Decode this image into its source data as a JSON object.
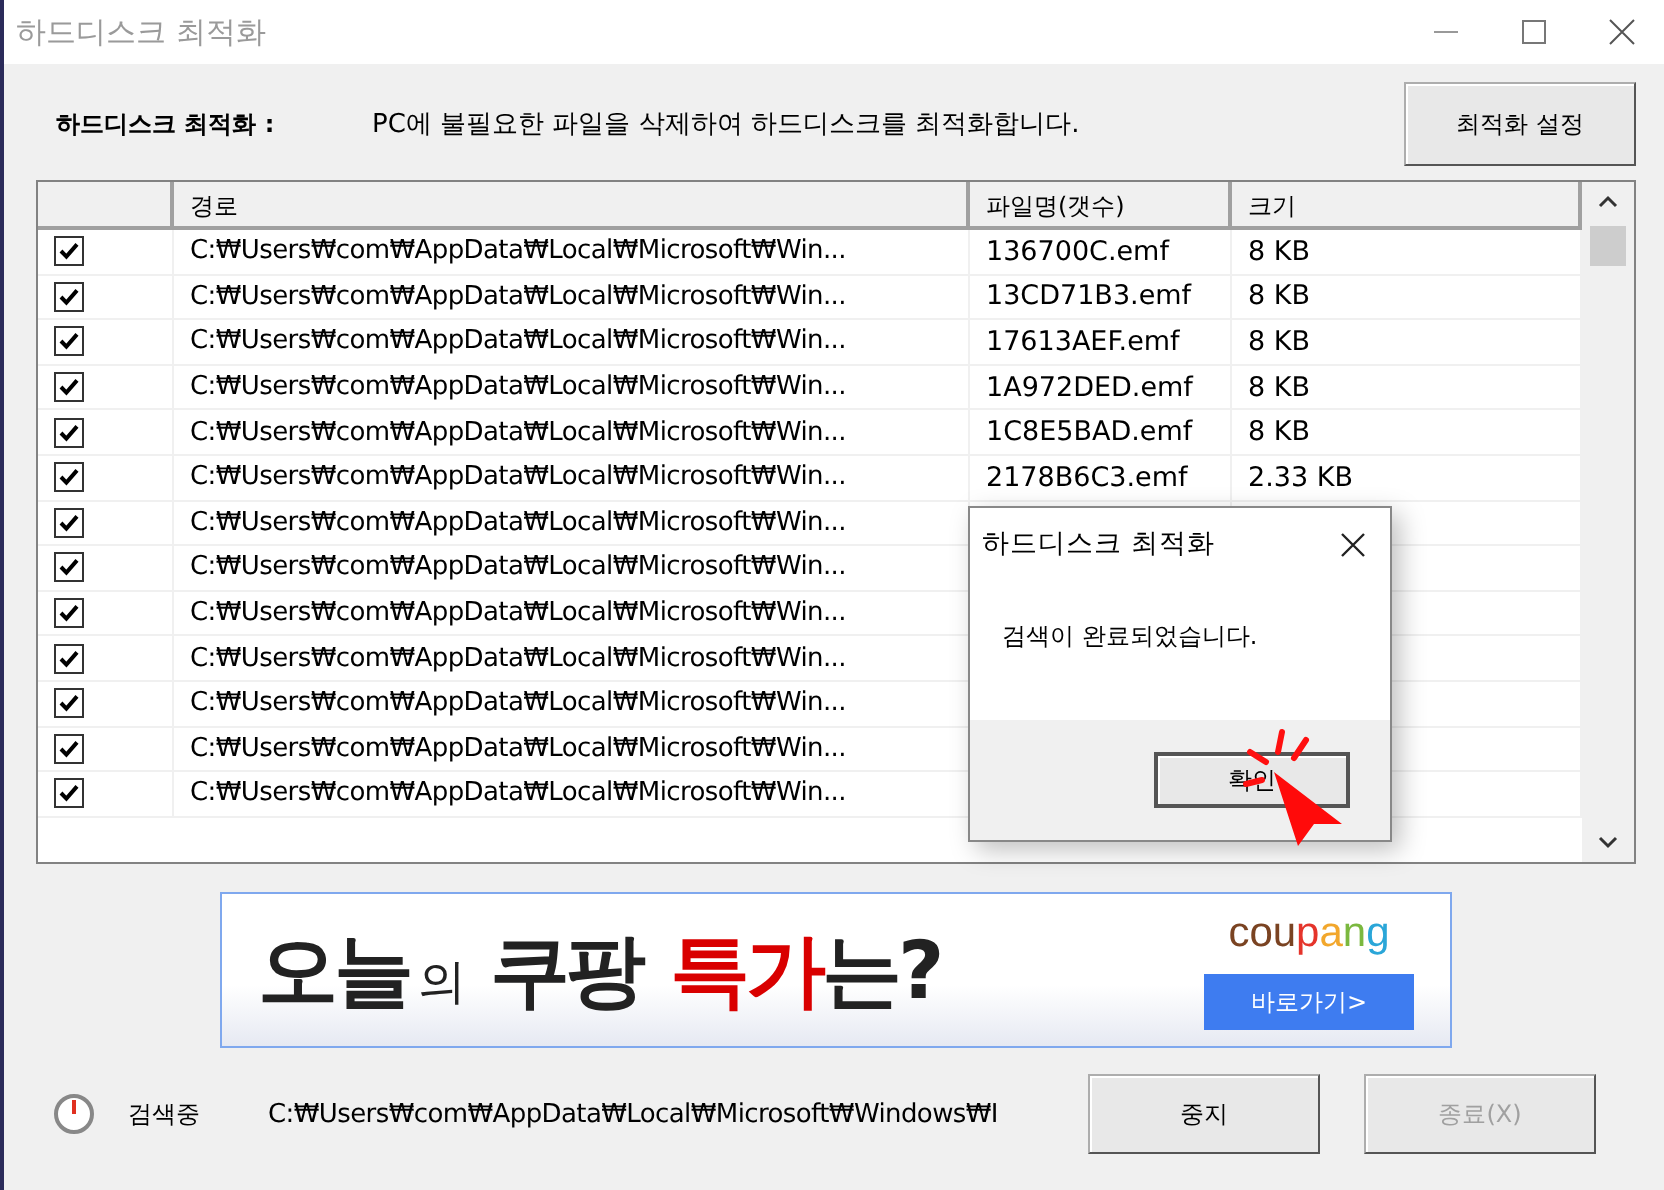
{
  "window": {
    "title": "하드디스크 최적화"
  },
  "header": {
    "label": "하드디스크 최적화 :",
    "description": "PC에 불필요한 파일을 삭제하여 하드디스크를 최적화합니다.",
    "settings_button": "최적화 설정"
  },
  "table": {
    "columns": [
      "경로",
      "파일명(갯수)",
      "크기"
    ],
    "rows": [
      {
        "checked": true,
        "path": "C:₩Users₩com₩AppData₩Local₩Microsoft₩Win...",
        "file": "136700C.emf",
        "size": "8 KB"
      },
      {
        "checked": true,
        "path": "C:₩Users₩com₩AppData₩Local₩Microsoft₩Win...",
        "file": "13CD71B3.emf",
        "size": "8 KB"
      },
      {
        "checked": true,
        "path": "C:₩Users₩com₩AppData₩Local₩Microsoft₩Win...",
        "file": "17613AEF.emf",
        "size": "8 KB"
      },
      {
        "checked": true,
        "path": "C:₩Users₩com₩AppData₩Local₩Microsoft₩Win...",
        "file": "1A972DED.emf",
        "size": "8 KB"
      },
      {
        "checked": true,
        "path": "C:₩Users₩com₩AppData₩Local₩Microsoft₩Win...",
        "file": "1C8E5BAD.emf",
        "size": "8 KB"
      },
      {
        "checked": true,
        "path": "C:₩Users₩com₩AppData₩Local₩Microsoft₩Win...",
        "file": "2178B6C3.emf",
        "size": "2.33 KB"
      },
      {
        "checked": true,
        "path": "C:₩Users₩com₩AppData₩Local₩Microsoft₩Win..."
      },
      {
        "checked": true,
        "path": "C:₩Users₩com₩AppData₩Local₩Microsoft₩Win..."
      },
      {
        "checked": true,
        "path": "C:₩Users₩com₩AppData₩Local₩Microsoft₩Win..."
      },
      {
        "checked": true,
        "path": "C:₩Users₩com₩AppData₩Local₩Microsoft₩Win..."
      },
      {
        "checked": true,
        "path": "C:₩Users₩com₩AppData₩Local₩Microsoft₩Win..."
      },
      {
        "checked": true,
        "path": "C:₩Users₩com₩AppData₩Local₩Microsoft₩Win..."
      },
      {
        "checked": true,
        "path": "C:₩Users₩com₩AppData₩Local₩Microsoft₩Win..."
      }
    ]
  },
  "dialog": {
    "title": "하드디스크 최적화",
    "message": "검색이 완료되었습니다.",
    "ok_button": "확인"
  },
  "ad": {
    "headline": [
      {
        "text": "오늘",
        "kind": "big"
      },
      {
        "text": "의",
        "kind": "small"
      },
      {
        "text": "쿠팡",
        "kind": "big"
      },
      {
        "text": "특가",
        "kind": "accent"
      },
      {
        "text": "는?",
        "kind": "big"
      }
    ],
    "brand": [
      {
        "text": "cou",
        "color": "#7a4322"
      },
      {
        "text": "p",
        "color": "#e5342b"
      },
      {
        "text": "a",
        "color": "#f2a72c"
      },
      {
        "text": "n",
        "color": "#7bb83f"
      },
      {
        "text": "g",
        "color": "#2aa6d8"
      }
    ],
    "button": "바로가기>"
  },
  "status": {
    "label": "검색중",
    "path": "C:₩Users₩com₩AppData₩Local₩Microsoft₩Windows₩I",
    "stop_button": "중지",
    "exit_button": {
      "label": "종료(X)",
      "disabled": true
    }
  }
}
